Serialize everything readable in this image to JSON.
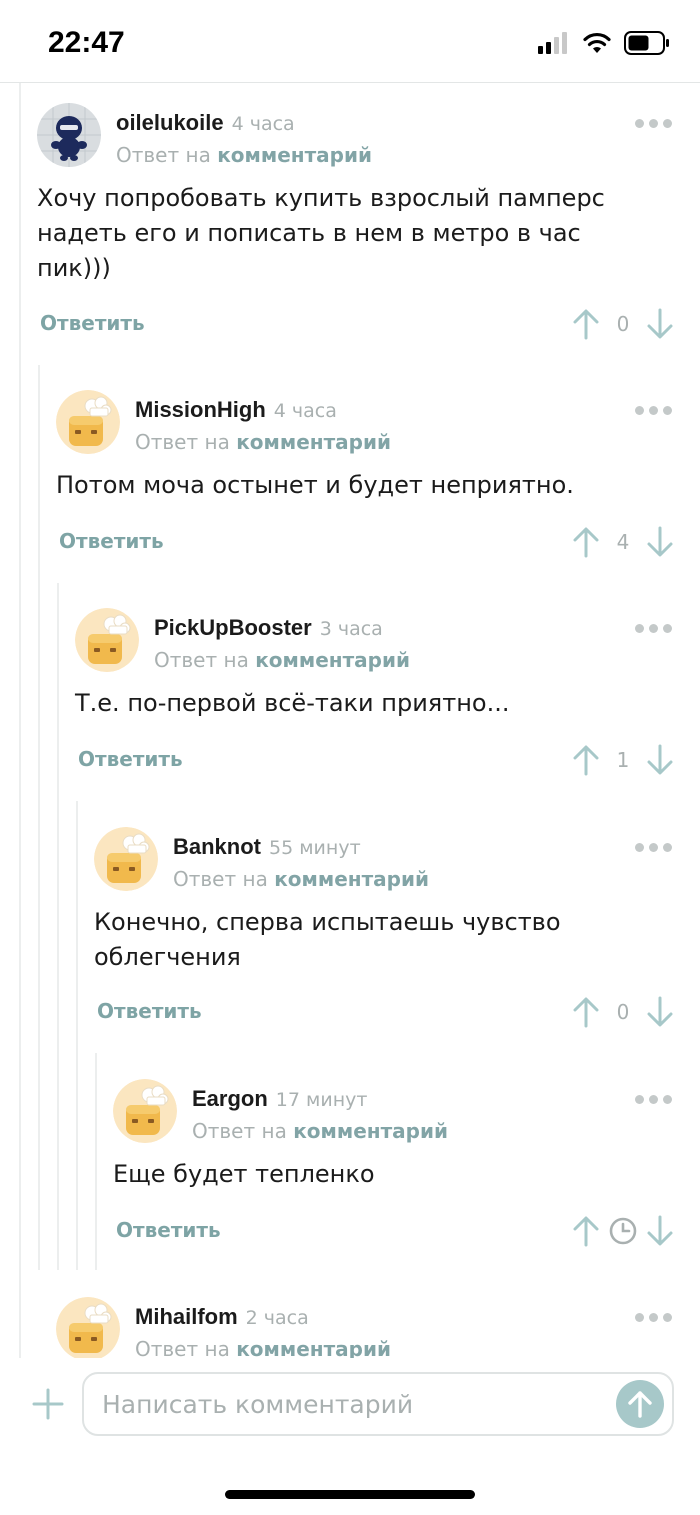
{
  "status_bar": {
    "time": "22:47"
  },
  "reply_label": "Ответить",
  "reply_to_prefix": "Ответ на",
  "reply_to_link": "комментарий",
  "comments": [
    {
      "author": "oilelukoile",
      "time": "4 часа",
      "text": "Хочу попробовать купить взрослый памперс надеть его и пописать в нем в метро в час пик)))",
      "votes": "0",
      "avatar": "ninja-figurine-photo"
    },
    {
      "author": "MissionHigh",
      "time": "4 часа",
      "text": "Потом моча остынет и будет неприятно.",
      "votes": "4",
      "avatar": "default-toast-avatar"
    },
    {
      "author": "PickUpBooster",
      "time": "3 часа",
      "text": "Т.е. по-первой всё-таки приятно...",
      "votes": "1",
      "avatar": "default-toast-avatar"
    },
    {
      "author": "Banknot",
      "time": "55 минут",
      "text": "Конечно, сперва испытаешь чувство облегчения",
      "votes": "0",
      "avatar": "default-toast-avatar"
    },
    {
      "author": "Eargon",
      "time": "17 минут",
      "text": "Еще будет тепленко",
      "votes_icon": "clock-icon",
      "avatar": "default-toast-avatar"
    },
    {
      "author": "Mihailfom",
      "time": "2 часа",
      "avatar": "default-toast-avatar"
    }
  ],
  "composer": {
    "placeholder": "Написать комментарий"
  },
  "colors": {
    "accent": "#7ea4a5",
    "muted": "#a9b0b0",
    "send_button": "#a7c8c9"
  }
}
